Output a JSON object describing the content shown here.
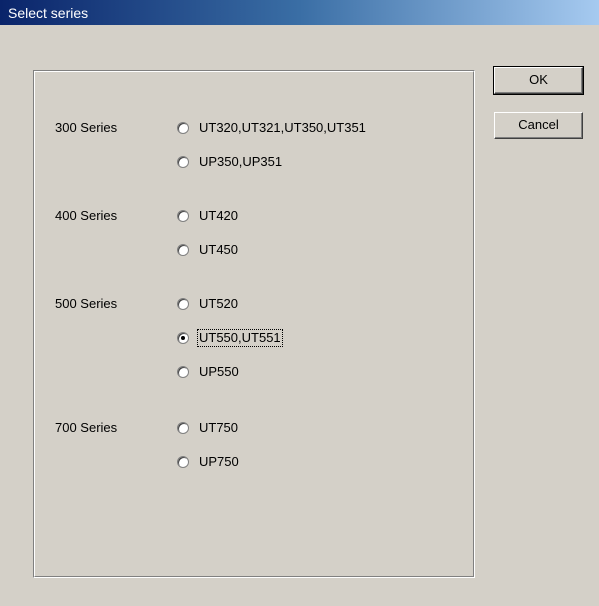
{
  "window": {
    "title": "Select series"
  },
  "groups": [
    {
      "label": "300 Series",
      "options": [
        {
          "label": "UT320,UT321,UT350,UT351",
          "checked": false
        },
        {
          "label": "UP350,UP351",
          "checked": false
        }
      ]
    },
    {
      "label": "400 Series",
      "options": [
        {
          "label": "UT420",
          "checked": false
        },
        {
          "label": "UT450",
          "checked": false
        }
      ]
    },
    {
      "label": "500 Series",
      "options": [
        {
          "label": "UT520",
          "checked": false
        },
        {
          "label": "UT550,UT551",
          "checked": true
        },
        {
          "label": "UP550",
          "checked": false
        }
      ]
    },
    {
      "label": "700 Series",
      "options": [
        {
          "label": "UT750",
          "checked": false
        },
        {
          "label": "UP750",
          "checked": false
        }
      ]
    }
  ],
  "buttons": {
    "ok_label": "OK",
    "cancel_label": "Cancel"
  },
  "colors": {
    "dialog_bg": "#d4d0c8",
    "titlebar_start": "#0a246a",
    "titlebar_end": "#a6caf0"
  }
}
